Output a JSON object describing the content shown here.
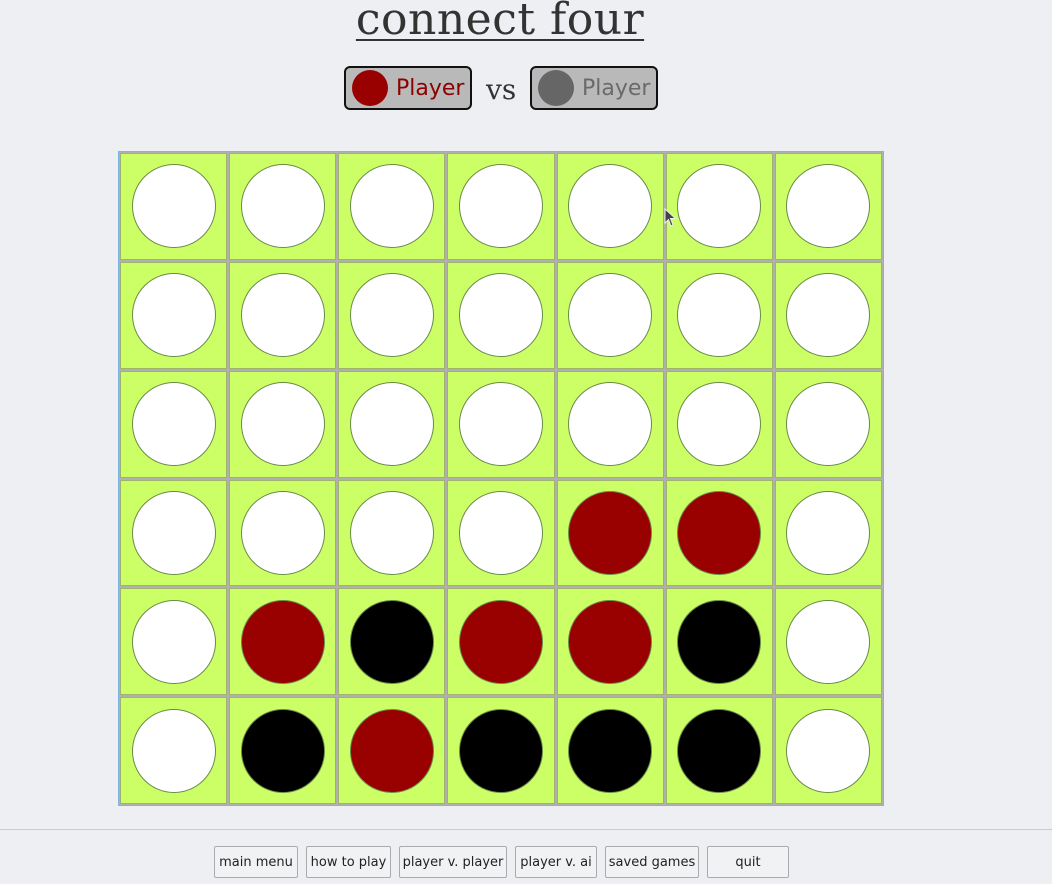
{
  "title": "connect four",
  "players": {
    "player1": {
      "label": "Player",
      "color": "#990000",
      "text_color": "#8b0000"
    },
    "vs_label": "vs",
    "player2": {
      "label": "Player",
      "color": "#666666",
      "text_color": "#6a6a6a"
    }
  },
  "board": {
    "cell_color": "#ccff66",
    "colors": {
      "empty": "#ffffff",
      "red": "#990000",
      "black": "#000000"
    },
    "rows": [
      [
        "empty",
        "empty",
        "empty",
        "empty",
        "empty",
        "empty",
        "empty"
      ],
      [
        "empty",
        "empty",
        "empty",
        "empty",
        "empty",
        "empty",
        "empty"
      ],
      [
        "empty",
        "empty",
        "empty",
        "empty",
        "empty",
        "empty",
        "empty"
      ],
      [
        "empty",
        "empty",
        "empty",
        "empty",
        "red",
        "red",
        "empty"
      ],
      [
        "empty",
        "red",
        "black",
        "red",
        "red",
        "black",
        "empty"
      ],
      [
        "empty",
        "black",
        "red",
        "black",
        "black",
        "black",
        "empty"
      ]
    ]
  },
  "menu": {
    "items": [
      {
        "label": "main menu",
        "name": "main-menu-button"
      },
      {
        "label": "how to play",
        "name": "how-to-play-button"
      },
      {
        "label": "player v. player",
        "name": "player-v-player-button"
      },
      {
        "label": "player v. ai",
        "name": "player-v-ai-button"
      },
      {
        "label": "saved games",
        "name": "saved-games-button"
      },
      {
        "label": "quit",
        "name": "quit-button"
      }
    ]
  }
}
